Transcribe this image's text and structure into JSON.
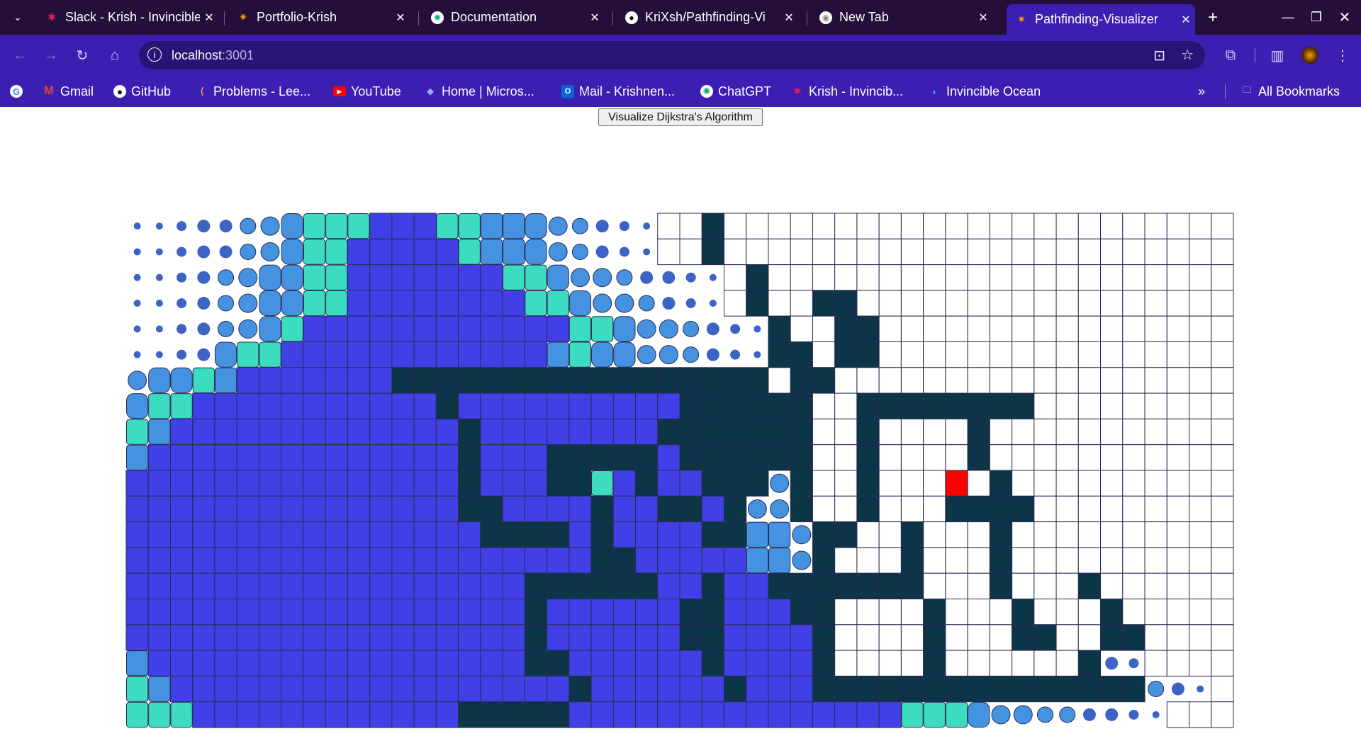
{
  "browser": {
    "tabs": [
      {
        "title": "Slack - Krish - Invincible",
        "icon": "slack-icon",
        "active": false
      },
      {
        "title": "Portfolio-Krish",
        "icon": "portfolio-icon",
        "active": false
      },
      {
        "title": "Documentation",
        "icon": "chatgpt-icon",
        "active": false
      },
      {
        "title": "KriXsh/Pathfinding-Vi",
        "icon": "github-icon",
        "active": false
      },
      {
        "title": "New Tab",
        "icon": "chrome-icon",
        "active": false
      },
      {
        "title": "Pathfinding-Visualizer",
        "icon": "portfolio-icon",
        "active": true
      }
    ],
    "url_host": "localhost",
    "url_port": ":3001",
    "bookmarks": [
      {
        "label": "Gmail",
        "icon": "gmail-icon"
      },
      {
        "label": "GitHub",
        "icon": "github-icon"
      },
      {
        "label": "Problems - Lee...",
        "icon": "leetcode-icon"
      },
      {
        "label": "YouTube",
        "icon": "youtube-icon"
      },
      {
        "label": "Home | Micros...",
        "icon": "microsoft-icon"
      },
      {
        "label": "Mail - Krishnen...",
        "icon": "outlook-icon"
      },
      {
        "label": "ChatGPT",
        "icon": "chatgpt-icon"
      },
      {
        "label": "Krish - Invincib...",
        "icon": "slack-icon"
      },
      {
        "label": "Invincible Ocean",
        "icon": "ocean-icon"
      }
    ],
    "all_bookmarks_label": "All Bookmarks"
  },
  "app": {
    "button_label": "Visualize Dijkstra's Algorithm",
    "colors": {
      "unvisited": "#ffffff",
      "wall": "#0c3547",
      "visited_dot": "#3d64c4",
      "visited_mid": "#4592e0",
      "visited_teal": "#3cdcc0",
      "visited_final": "#4040e6",
      "finish": "#ff0000",
      "border": "#2a2a55"
    },
    "legend_codes": "w=wall, .=unvisited, B=visited (settled), F=finish node, 1..4 dot sizes (small to large), 5=circle, 6=rounded square, 7=teal square, 8=blue rounded square",
    "grid": [
      "11233456777BBB7788654321..w.....................................",
      "1123345677BBBBB788654321..w....................................",
      "1123456677BBBBBBB7765543321.w.................................",
      "1123456677BBBBBBBB776554321.w..ww...............................",
      "11234567BBBBBBBBBBBB776554321w..ww...............................",
      "1123677BBBBBBBBBBBB8766554321ww.ww...............................",
      "56678BBBBBBBwwwwwwwwwwwwwwwww.ww...............................",
      "677BBBBBBBBBBBwBBBBBBBBBBwwwwww..wwwwwwww......................",
      "78BBBBBBBBBBBBBwBBBBBBBBwwwwwww..w....w....................",
      "8BBBBBBBBBBBBBBwBBBwwwwwBwwwwww..w....w....................",
      "BBBBBBBBBBBBBBBwBBBww7BwBBwww5w..w...F.w....................",
      "BBBBBBBBBBBBBBBwwBBBBwBBwwBw55w..w...wwww...................",
      "BBBBBBBBBBBBBBBBwwwwBwBBBBww885ww..w...w........................",
      "BBBBBBBBBBBBBBBBBBBBBwwBBBBB885w...w...w........................",
      "BBBBBBBBBBBBBBBBBBwwwwwwBBwBBwwwwwww...w...w........................",
      "BBBBBBBBBBBBBBBBBBwBBBBBBwwBBBww....w...w...w.......................",
      "BBBBBBBBBBBBBBBBBBwBBBBBBwwBBBBw....w...ww..ww......................",
      "8BBBBBBBBBBBBBBBBBwwBBBBBBwBBBBw....w......w32....................",
      "78BBBBBBBBBBBBBBBBBBwBBBBBBwBBBwwwwwwwwwwwwwww431..................",
      "777BBBBBBBBBBBBwwwwwBBBBBBBBBBBBBBB777655443321..................."
    ]
  }
}
